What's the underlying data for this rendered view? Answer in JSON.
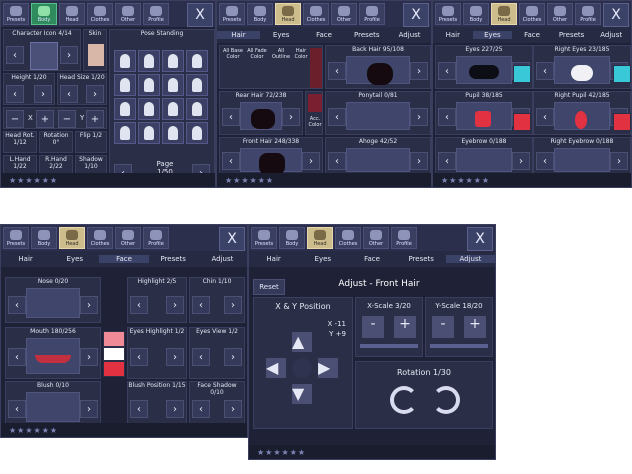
{
  "common": {
    "tabs": [
      "Presets",
      "Body",
      "Head",
      "Clothes",
      "Other",
      "Profile"
    ],
    "close": "X",
    "footer": "★★★★★★"
  },
  "body_panel": {
    "character_icon": "Character Icon 4/14",
    "skin": "Skin",
    "pose_standing": "Pose Standing",
    "height": "Height 1/20",
    "head_size": "Head Size 1/20",
    "x_label": "X",
    "y_label": "Y",
    "head_rot": "Head Rot. 1/12",
    "rotation": "Rotation 0°",
    "flip": "Flip 1/2",
    "lhand": "L.Hand 1/22",
    "rhand": "R.Hand 2/22",
    "shadow": "Shadow 1/10",
    "page": "Page",
    "page_count": "1/50"
  },
  "hair_panel": {
    "subtabs": [
      "Hair",
      "Eyes",
      "Face",
      "Presets",
      "Adjust"
    ],
    "back_hair": "Back Hair 95/108",
    "rear_hair": "Rear Hair 72/238",
    "ponytail": "Ponytail 0/81",
    "front_hair": "Front Hair 248/338",
    "ahoge": "Ahoge 42/52",
    "color_opts": [
      "All Base Color",
      "All Fade Color",
      "All Outline",
      "Hair Color"
    ],
    "acc_color": "Acc. Color"
  },
  "eyes_panel": {
    "subtabs": [
      "Hair",
      "Eyes",
      "Face",
      "Presets",
      "Adjust"
    ],
    "eyes": "Eyes 227/25",
    "right_eyes": "Right Eyes 23/185",
    "pupil": "Pupil 38/185",
    "right_pupil": "Right Pupil 42/185",
    "eyebrow": "Eyebrow 0/188",
    "right_eyebrow": "Right Eyebrow 0/188"
  },
  "face_panel": {
    "subtabs": [
      "Hair",
      "Eyes",
      "Face",
      "Presets",
      "Adjust"
    ],
    "nose": "Nose 0/20",
    "highlight": "Highlight 2/5",
    "chin": "Chin 1/10",
    "mouth": "Mouth 180/256",
    "eyes_highlight": "Eyes Highlight 1/2",
    "eyes_view": "Eyes View 1/2",
    "blush": "Blush 0/10",
    "blush_position": "Blush Position 1/15",
    "face_shadow": "Face Shadow 0/10"
  },
  "adjust_panel": {
    "tabs": [
      "Presets",
      "Body",
      "Head",
      "Clothes",
      "Other",
      "Profile"
    ],
    "subtabs": [
      "Hair",
      "Eyes",
      "Face",
      "Presets",
      "Adjust"
    ],
    "reset": "Reset",
    "title": "Adjust - Front Hair",
    "xy_label": "X & Y Position",
    "x_val": "X -11",
    "y_val": "Y +9",
    "x_scale": "X-Scale 3/20",
    "y_scale": "Y-Scale 18/20",
    "rotation": "Rotation 1/30",
    "minus": "-",
    "plus": "+"
  },
  "colors": {
    "bg": "#1f2236",
    "accent": "#2f8a5d",
    "head": "#cdbd8d",
    "cyan": "#39c8d8",
    "red": "#e23140",
    "pink": "#f08a96"
  }
}
